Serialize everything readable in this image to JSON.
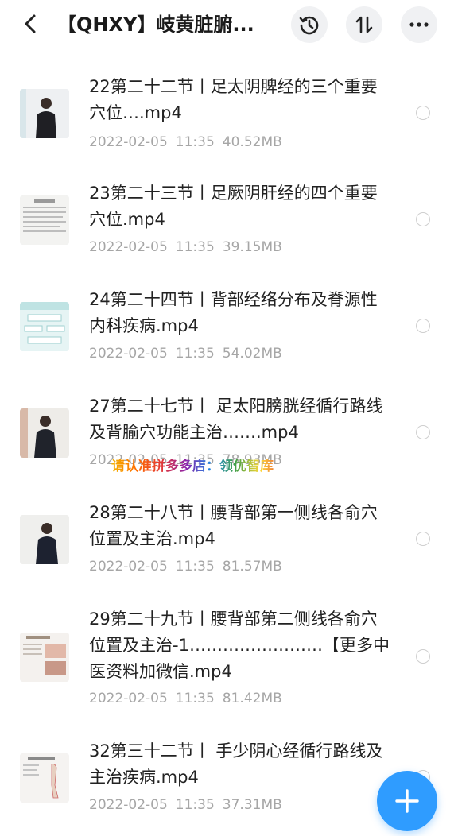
{
  "header": {
    "title": "【QHXY】岐黄脏腑...",
    "back_icon": "chevron-left-icon",
    "history_icon": "history-icon",
    "sort_icon": "sort-icon",
    "more_icon": "more-dots-icon"
  },
  "files": [
    {
      "name": "22第二十二节丨足太阴脾经的三个重要穴位….mp4",
      "date": "2022-02-05",
      "time": "11:35",
      "size": "40.52MB",
      "thumb": "man-presenter"
    },
    {
      "name": "23第二十三节丨足厥阴肝经的四个重要穴位.mp4",
      "date": "2022-02-05",
      "time": "11:35",
      "size": "39.15MB",
      "thumb": "text-slide"
    },
    {
      "name": "24第二十四节丨背部经络分布及脊源性内科疾病.mp4",
      "date": "2022-02-05",
      "time": "11:35",
      "size": "54.02MB",
      "thumb": "diagram-slide"
    },
    {
      "name": "27第二十七节丨 足太阳膀胱经循行路线及背腧穴功能主治…….mp4",
      "date": "2022-02-05",
      "time": "11:35",
      "size": "78.93MB",
      "thumb": "man-presenter"
    },
    {
      "name": "28第二十八节丨腰背部第一侧线各俞穴位置及主治.mp4",
      "date": "2022-02-05",
      "time": "11:35",
      "size": "81.57MB",
      "thumb": "man-presenter"
    },
    {
      "name": "29第二十九节丨腰背部第二侧线各俞穴位置及主治-1……………………【更多中医资料加微信.mp4",
      "date": "2022-02-05",
      "time": "11:35",
      "size": "81.42MB",
      "thumb": "photo-slide"
    },
    {
      "name": "32第三十二节丨 手少阴心经循行路线及主治疾病.mp4",
      "date": "2022-02-05",
      "time": "11:35",
      "size": "37.31MB",
      "thumb": "body-slide"
    }
  ],
  "watermark": "请认准拼多多店：领优智库",
  "colors": {
    "accent": "#2f9cff",
    "meta": "#a6a6a6"
  },
  "fab_icon": "plus-icon"
}
